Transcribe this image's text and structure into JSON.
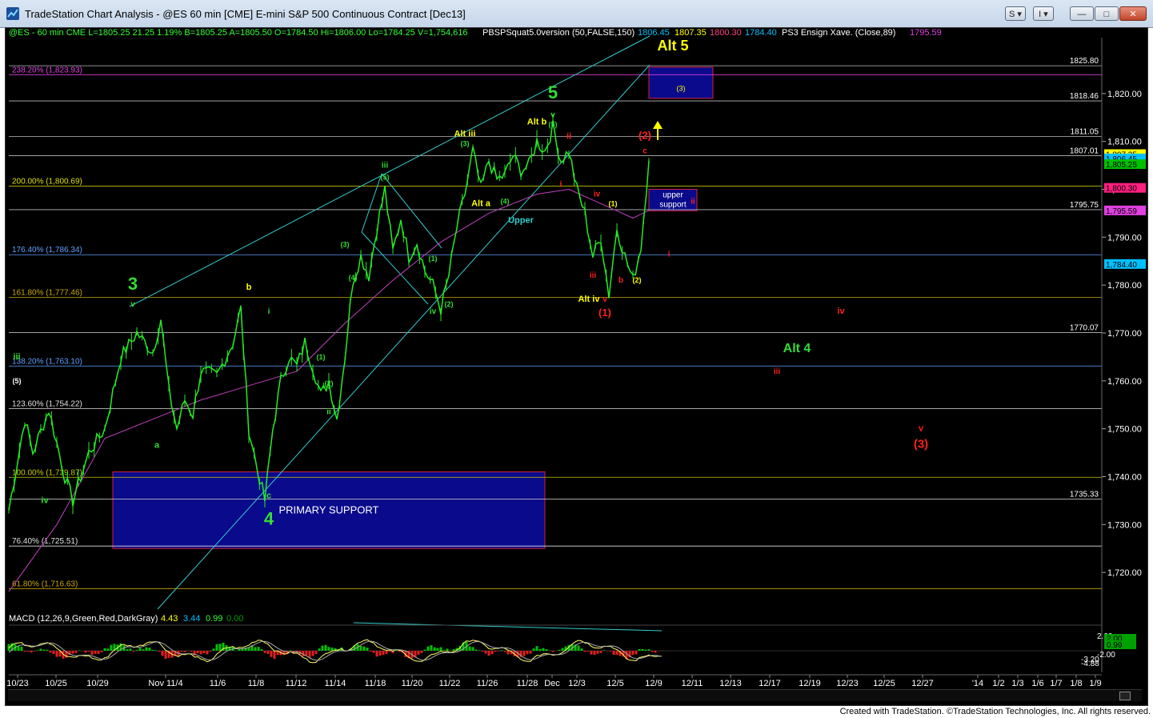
{
  "window": {
    "title": "TradeStation Chart Analysis - @ES 60 min [CME] E-mini S&P 500 Continuous Contract [Dec13]",
    "buttons": [
      "S",
      "I",
      "—",
      "□",
      "✕"
    ]
  },
  "footer": {
    "credit": "Created with TradeStation. ©TradeStation Technologies, Inc. All rights reserved."
  },
  "colors": {
    "background": "#000000",
    "price": "#00ff00",
    "ma": "#c040c0",
    "trendline": "#33cccc",
    "support_box": "#0a0a8c",
    "fib": "#c8c800",
    "red": "#ff2020",
    "yellow": "#ffff00"
  },
  "header": {
    "symbol_info": "@ES - 60 min  CME  L=1805.25  21.25  1.19%  B=1805.25  A=1805.50  O=1784.50  Hi=1806.00  Lo=1784.25  V=1,754,616",
    "indicator": "PBSPSquat5.0version (50,FALSE,150)",
    "ind_v1": "1806.45",
    "ind_v2": "1807.35",
    "ind_v3": "1800.30",
    "ind_v4": "1784.40",
    "xave": "PS3 Ensign Xave. (Close,89)",
    "xave_v": "1795.59"
  },
  "macd_legend": {
    "label": "MACD (12,26,9,Green,Red,DarkGray)",
    "v1": "4.43",
    "v2": "3.44",
    "v3": "0.99",
    "v4": "0.00"
  },
  "chart_data": {
    "type": "line",
    "title": "@ES 60 min",
    "x_ticks": [
      "10/23",
      "10/25",
      "10/29",
      "Nov 11/4",
      "11/6",
      "11/8",
      "11/12",
      "11/14",
      "11/18",
      "11/20",
      "11/22",
      "11/26",
      "11/28",
      "Dec",
      "12/3",
      "12/5",
      "12/9",
      "12/11",
      "12/13",
      "12/17",
      "12/19",
      "12/23",
      "12/25",
      "12/27",
      "'14",
      "1/2",
      "1/3",
      "1/6",
      "1/7",
      "1/8",
      "1/9"
    ],
    "y_ticks": [
      "1,720.00",
      "1,730.00",
      "1,740.00",
      "1,750.00",
      "1,760.00",
      "1,770.00",
      "1,780.00",
      "1,790.00",
      "1,800.00",
      "1,810.00",
      "1,820.00"
    ],
    "ylim": [
      1712,
      1830
    ],
    "price_path": [
      [
        0,
        1733
      ],
      [
        2,
        1752
      ],
      [
        3,
        1745
      ],
      [
        5,
        1754
      ],
      [
        7,
        1740
      ],
      [
        8,
        1735
      ],
      [
        10,
        1745
      ],
      [
        12,
        1750
      ],
      [
        14,
        1765
      ],
      [
        16,
        1770
      ],
      [
        18,
        1766
      ],
      [
        19,
        1773
      ],
      [
        20,
        1758
      ],
      [
        21,
        1750
      ],
      [
        22,
        1756
      ],
      [
        23,
        1753
      ],
      [
        24,
        1762
      ],
      [
        26,
        1761
      ],
      [
        28,
        1768
      ],
      [
        29,
        1775
      ],
      [
        30,
        1750
      ],
      [
        31,
        1742
      ],
      [
        32,
        1735
      ],
      [
        33,
        1750
      ],
      [
        34,
        1760
      ],
      [
        35,
        1765
      ],
      [
        36,
        1763
      ],
      [
        37,
        1768
      ],
      [
        38,
        1763
      ],
      [
        39,
        1757
      ],
      [
        40,
        1760
      ],
      [
        41,
        1752
      ],
      [
        42,
        1765
      ],
      [
        43,
        1781
      ],
      [
        44,
        1786
      ],
      [
        45,
        1782
      ],
      [
        46,
        1792
      ],
      [
        47,
        1800
      ],
      [
        48,
        1787
      ],
      [
        49,
        1794
      ],
      [
        50,
        1786
      ],
      [
        51,
        1789
      ],
      [
        52,
        1783
      ],
      [
        53,
        1780
      ],
      [
        54,
        1775
      ],
      [
        55,
        1782
      ],
      [
        56,
        1792
      ],
      [
        57,
        1799
      ],
      [
        58,
        1808
      ],
      [
        59,
        1800
      ],
      [
        60,
        1806
      ],
      [
        61,
        1802
      ],
      [
        62,
        1803
      ],
      [
        63,
        1807
      ],
      [
        64,
        1804
      ],
      [
        65,
        1805
      ],
      [
        66,
        1810
      ],
      [
        67,
        1808
      ],
      [
        68,
        1813
      ],
      [
        69,
        1806
      ],
      [
        70,
        1808
      ],
      [
        71,
        1800
      ],
      [
        72,
        1795
      ],
      [
        73,
        1786
      ],
      [
        74,
        1790
      ],
      [
        75,
        1778
      ],
      [
        76,
        1792
      ],
      [
        77,
        1786
      ],
      [
        78,
        1781
      ],
      [
        79,
        1788
      ],
      [
        80,
        1806
      ]
    ],
    "ma_path": [
      [
        0,
        1716
      ],
      [
        6,
        1730
      ],
      [
        12,
        1748
      ],
      [
        18,
        1752
      ],
      [
        24,
        1756
      ],
      [
        30,
        1759
      ],
      [
        36,
        1762
      ],
      [
        42,
        1772
      ],
      [
        48,
        1781
      ],
      [
        54,
        1789
      ],
      [
        60,
        1795
      ],
      [
        66,
        1799
      ],
      [
        70,
        1800
      ],
      [
        74,
        1797
      ],
      [
        78,
        1794
      ],
      [
        80,
        1795.6
      ]
    ],
    "horizontal_levels": [
      {
        "label": "1825.80",
        "value": 1825.8
      },
      {
        "label": "1818.46",
        "value": 1818.46
      },
      {
        "label": "1811.05",
        "value": 1811.05
      },
      {
        "label": "1807.01",
        "value": 1807.01
      },
      {
        "label": "1795.75",
        "value": 1795.75
      },
      {
        "label": "1770.07",
        "value": 1770.07
      },
      {
        "label": "1735.33",
        "value": 1735.33
      }
    ],
    "fib_levels": [
      {
        "label": "238.20% (1,823.93)",
        "value": 1823.93,
        "color": "#e040e0"
      },
      {
        "label": "200.00% (1,800.69)",
        "value": 1800.69,
        "color": "#e0e000"
      },
      {
        "label": "176.40% (1,786.34)",
        "value": 1786.34,
        "color": "#5fa0ff"
      },
      {
        "label": "161.80% (1,777.46)",
        "value": 1777.46,
        "color": "#c8a800"
      },
      {
        "label": "138.20% (1,763.10)",
        "value": 1763.1,
        "color": "#5fa0ff"
      },
      {
        "label": "123.60% (1,754.22)",
        "value": 1754.22,
        "color": "#e0e0e0"
      },
      {
        "label": "100.00% (1,739.87)",
        "value": 1739.87,
        "color": "#c8c800"
      },
      {
        "label": "76.40% (1,725.51)",
        "value": 1725.51,
        "color": "#e0e0e0"
      },
      {
        "label": "61.80% (1,716.63)",
        "value": 1716.63,
        "color": "#c8a800"
      }
    ],
    "price_badges": [
      {
        "label": "1,807.35",
        "value": 1807.35,
        "color": "#ffff00",
        "text": "#000"
      },
      {
        "label": "1,806.45",
        "value": 1806.45,
        "color": "#00c0ff",
        "text": "#000"
      },
      {
        "label": "1,805.25",
        "value": 1805.25,
        "color": "#00c000",
        "text": "#000"
      },
      {
        "label": "1,800.30",
        "value": 1800.3,
        "color": "#ff2080",
        "text": "#000"
      },
      {
        "label": "1,795.59",
        "value": 1795.59,
        "color": "#e040e0",
        "text": "#000"
      },
      {
        "label": "1,784.40",
        "value": 1784.4,
        "color": "#00c0ff",
        "text": "#000"
      }
    ],
    "boxes": [
      {
        "label": "PRIMARY SUPPORT",
        "x1": 13,
        "x2": 67,
        "y1": 1741,
        "y2": 1725
      },
      {
        "label": "upper support",
        "x1": 80,
        "x2": 86,
        "y1": 1800,
        "y2": 1795.5
      },
      {
        "label": "(3)",
        "x1": 80,
        "x2": 88,
        "y1": 1825.5,
        "y2": 1819
      }
    ],
    "macd_ticks": [
      "2.00",
      "-2.00",
      "-3.20",
      "-4.88"
    ],
    "macd_badges": [
      {
        "label": "2.00",
        "color": "#00a000"
      },
      {
        "label": "0.99",
        "color": "#00a000"
      }
    ],
    "wave_labels": [
      {
        "t": "5",
        "x": 68,
        "y": 1819,
        "c": "#33dd33",
        "s": 22
      },
      {
        "t": "v",
        "x": 68,
        "y": 1815,
        "c": "#33dd33",
        "s": 10
      },
      {
        "t": "(5)",
        "x": 68,
        "y": 1813,
        "c": "#33dd33",
        "s": 9
      },
      {
        "t": "Alt b",
        "x": 66,
        "y": 1813.5,
        "c": "#ffff00",
        "s": 11
      },
      {
        "t": "Alt iii",
        "x": 57,
        "y": 1811,
        "c": "#ffff00",
        "s": 11
      },
      {
        "t": "(3)",
        "x": 57,
        "y": 1809,
        "c": "#33dd33",
        "s": 9
      },
      {
        "t": "iii",
        "x": 47,
        "y": 1804.5,
        "c": "#33dd33",
        "s": 10
      },
      {
        "t": "(5)",
        "x": 47,
        "y": 1802,
        "c": "#33dd33",
        "s": 9
      },
      {
        "t": "Alt a",
        "x": 59,
        "y": 1796.5,
        "c": "#ffff00",
        "s": 11
      },
      {
        "t": "(4)",
        "x": 62,
        "y": 1797,
        "c": "#33dd33",
        "s": 9
      },
      {
        "t": "Upper",
        "x": 64,
        "y": 1793,
        "c": "#33cccc",
        "s": 11
      },
      {
        "t": "(3)",
        "x": 42,
        "y": 1788,
        "c": "#33dd33",
        "s": 9
      },
      {
        "t": "(4)",
        "x": 43,
        "y": 1781,
        "c": "#33dd33",
        "s": 9
      },
      {
        "t": "(1)",
        "x": 53,
        "y": 1785,
        "c": "#33dd33",
        "s": 9
      },
      {
        "t": "iv",
        "x": 53,
        "y": 1774,
        "c": "#33dd33",
        "s": 10
      },
      {
        "t": "(2)",
        "x": 55,
        "y": 1775.5,
        "c": "#33dd33",
        "s": 9
      },
      {
        "t": "3",
        "x": 15.5,
        "y": 1779,
        "c": "#33dd33",
        "s": 22
      },
      {
        "t": "v",
        "x": 15.5,
        "y": 1775.5,
        "c": "#33dd33",
        "s": 10
      },
      {
        "t": "b",
        "x": 30,
        "y": 1779,
        "c": "#ffff00",
        "s": 11
      },
      {
        "t": "a",
        "x": 18.5,
        "y": 1746,
        "c": "#33dd33",
        "s": 11
      },
      {
        "t": "c",
        "x": 32.5,
        "y": 1735.5,
        "c": "#33dd33",
        "s": 11
      },
      {
        "t": "4",
        "x": 32.5,
        "y": 1730,
        "c": "#33dd33",
        "s": 22
      },
      {
        "t": "iii",
        "x": 1,
        "y": 1764.5,
        "c": "#33dd33",
        "s": 11
      },
      {
        "t": "(5)",
        "x": 1,
        "y": 1759.5,
        "c": "#ffffff",
        "s": 9
      },
      {
        "t": "iv",
        "x": 4.5,
        "y": 1734.5,
        "c": "#33dd33",
        "s": 11
      },
      {
        "t": "i",
        "x": 32.5,
        "y": 1774,
        "c": "#33dd33",
        "s": 10
      },
      {
        "t": "(1)",
        "x": 39,
        "y": 1764.5,
        "c": "#33dd33",
        "s": 9
      },
      {
        "t": "(2)",
        "x": 40,
        "y": 1759,
        "c": "#33dd33",
        "s": 9
      },
      {
        "t": "ii",
        "x": 40,
        "y": 1753,
        "c": "#33dd33",
        "s": 10
      },
      {
        "t": "ii",
        "x": 70,
        "y": 1810.5,
        "c": "#ff2020",
        "s": 11
      },
      {
        "t": "i",
        "x": 69,
        "y": 1800.5,
        "c": "#ff2020",
        "s": 11
      },
      {
        "t": "iii",
        "x": 73,
        "y": 1781.5,
        "c": "#ff2020",
        "s": 10
      },
      {
        "t": "(1)",
        "x": 75.5,
        "y": 1796.5,
        "c": "#ffff00",
        "s": 9
      },
      {
        "t": "iv",
        "x": 73.5,
        "y": 1798.5,
        "c": "#ff2020",
        "s": 10
      },
      {
        "t": "b",
        "x": 76.5,
        "y": 1780.5,
        "c": "#ff2020",
        "s": 10
      },
      {
        "t": "(2)",
        "x": 78.5,
        "y": 1780.5,
        "c": "#ffff00",
        "s": 9
      },
      {
        "t": "Alt iv",
        "x": 72.5,
        "y": 1776.5,
        "c": "#ffff00",
        "s": 11
      },
      {
        "t": "v",
        "x": 74.5,
        "y": 1776.5,
        "c": "#ff2020",
        "s": 10
      },
      {
        "t": "(1)",
        "x": 74.5,
        "y": 1773.5,
        "c": "#ff2020",
        "s": 13
      },
      {
        "t": "(2)",
        "x": 79.5,
        "y": 1810.5,
        "c": "#ff2020",
        "s": 13
      },
      {
        "t": "c",
        "x": 79.5,
        "y": 1807.5,
        "c": "#ff2020",
        "s": 10
      },
      {
        "t": "ii",
        "x": 85.5,
        "y": 1797,
        "c": "#ff2020",
        "s": 10
      },
      {
        "t": "i",
        "x": 82.5,
        "y": 1786,
        "c": "#ff2020",
        "s": 10
      },
      {
        "t": "iv",
        "x": 104,
        "y": 1774,
        "c": "#ff2020",
        "s": 11
      },
      {
        "t": "iii",
        "x": 96,
        "y": 1761.5,
        "c": "#ff2020",
        "s": 10
      },
      {
        "t": "v",
        "x": 114,
        "y": 1749.5,
        "c": "#ff2020",
        "s": 11
      },
      {
        "t": "(3)",
        "x": 114,
        "y": 1746,
        "c": "#ff2020",
        "s": 15
      },
      {
        "t": "Alt 4",
        "x": 98.5,
        "y": 1766,
        "c": "#33dd33",
        "s": 16
      },
      {
        "t": "Alt 5",
        "x": 83,
        "y": 1829,
        "c": "#ffff00",
        "s": 18
      }
    ]
  }
}
